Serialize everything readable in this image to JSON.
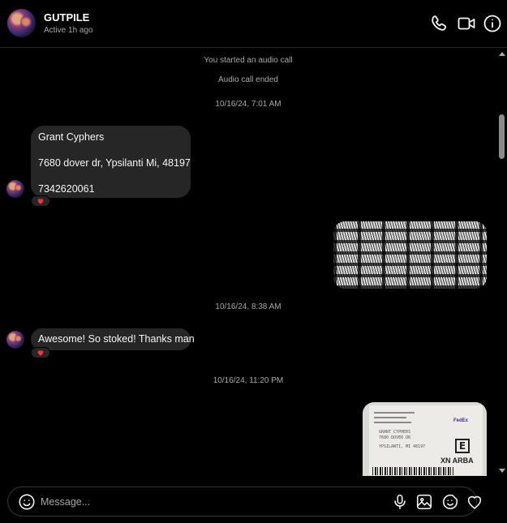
{
  "header": {
    "name": "GUTPILE",
    "status": "Active 1h ago",
    "icons": [
      "phone-icon",
      "video-camera-icon",
      "info-icon"
    ]
  },
  "thread": {
    "system_events": [
      "You started an audio call",
      "Audio call ended"
    ],
    "timestamps": [
      "10/16/24, 7:01 AM",
      "10/16/24, 8:38 AM",
      "10/16/24, 11:20 PM"
    ],
    "messages": [
      {
        "sender": "GUTPILE",
        "lines": [
          "Grant Cyphers",
          "7680 dover dr, Ypsilanti Mi, 48197",
          "7342620061"
        ],
        "reaction": "heart"
      },
      {
        "sender": "me",
        "type": "photo",
        "subject": "photo"
      },
      {
        "sender": "GUTPILE",
        "text": "Awesome! So stoked! Thanks man",
        "reaction": "heart"
      },
      {
        "sender": "me",
        "type": "photo",
        "label_text": {
          "name": "GRANT CYPHERS",
          "street": "7680 DOVER DR",
          "city": "YPSILANTI, MI 48197",
          "carrier": "FedEx",
          "service": "E",
          "code": "XN ARBA"
        }
      }
    ]
  },
  "composer": {
    "placeholder": "Message...",
    "icons": [
      "emoji-icon",
      "microphone-icon",
      "image-icon",
      "sticker-icon",
      "heart-icon"
    ]
  },
  "colors": {
    "background": "#000000",
    "bubble": "#262626",
    "muted_text": "#a8a8a8",
    "reaction_heart": "#ff3040"
  }
}
